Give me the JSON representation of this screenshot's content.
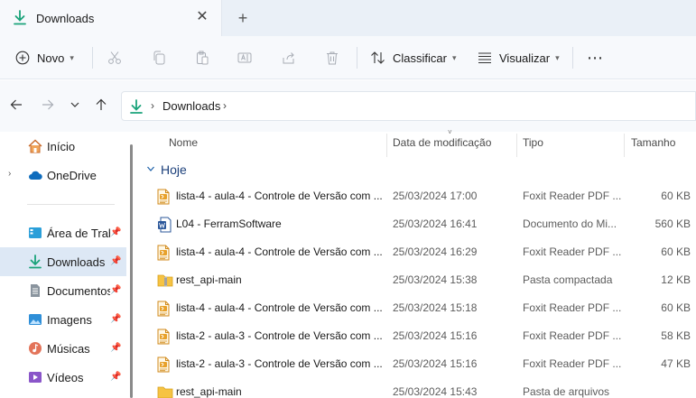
{
  "tab": {
    "title": "Downloads",
    "close_glyph": "✕",
    "new_tab_glyph": "+"
  },
  "toolbar": {
    "new_label": "Novo",
    "sort_label": "Classificar",
    "view_label": "Visualizar",
    "more_glyph": "⋯",
    "icons": [
      "plus-circle-icon",
      "cut-icon",
      "copy-icon",
      "paste-icon",
      "rename-icon",
      "share-icon",
      "delete-icon",
      "sort-icon",
      "view-icon",
      "more-icon"
    ]
  },
  "address": {
    "crumb": "Downloads",
    "sep": "›"
  },
  "sidebar": {
    "items": [
      {
        "label": "Início",
        "icon": "home-icon"
      },
      {
        "label": "OneDrive",
        "icon": "cloud-icon"
      },
      {
        "label": "Área de Trabalho",
        "icon": "desktop-icon"
      },
      {
        "label": "Downloads",
        "icon": "download-icon"
      },
      {
        "label": "Documentos",
        "icon": "documents-icon"
      },
      {
        "label": "Imagens",
        "icon": "pictures-icon"
      },
      {
        "label": "Músicas",
        "icon": "music-icon"
      },
      {
        "label": "Vídeos",
        "icon": "videos-icon"
      }
    ]
  },
  "columns": {
    "name": "Nome",
    "date": "Data de modificação",
    "type": "Tipo",
    "size": "Tamanho"
  },
  "group": {
    "title": "Hoje"
  },
  "files": [
    {
      "name": "lista-4 - aula-4 - Controle de Versão com ...",
      "date": "25/03/2024 17:00",
      "type": "Foxit Reader PDF ...",
      "size": "60 KB",
      "icon": "pdf-icon"
    },
    {
      "name": "L04 - FerramSoftware",
      "date": "25/03/2024 16:41",
      "type": "Documento do Mi...",
      "size": "560 KB",
      "icon": "word-icon"
    },
    {
      "name": "lista-4 - aula-4 - Controle de Versão com ...",
      "date": "25/03/2024 16:29",
      "type": "Foxit Reader PDF ...",
      "size": "60 KB",
      "icon": "pdf-icon"
    },
    {
      "name": "rest_api-main",
      "date": "25/03/2024 15:38",
      "type": "Pasta compactada",
      "size": "12 KB",
      "icon": "zip-folder-icon"
    },
    {
      "name": "lista-4 - aula-4 - Controle de Versão com ...",
      "date": "25/03/2024 15:18",
      "type": "Foxit Reader PDF ...",
      "size": "60 KB",
      "icon": "pdf-icon"
    },
    {
      "name": "lista-2 - aula-3 - Controle de Versão com ...",
      "date": "25/03/2024 15:16",
      "type": "Foxit Reader PDF ...",
      "size": "58 KB",
      "icon": "pdf-icon"
    },
    {
      "name": "lista-2 - aula-3 - Controle de Versão com ...",
      "date": "25/03/2024 15:16",
      "type": "Foxit Reader PDF ...",
      "size": "47 KB",
      "icon": "pdf-icon"
    },
    {
      "name": "rest_api-main",
      "date": "25/03/2024 15:43",
      "type": "Pasta de arquivos",
      "size": "",
      "icon": "folder-icon"
    }
  ]
}
